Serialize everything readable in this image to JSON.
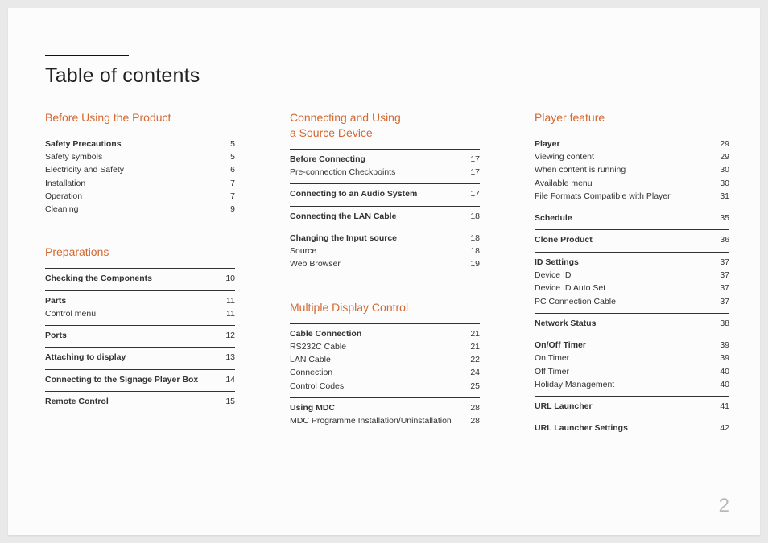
{
  "title": "Table of contents",
  "pageNumber": "2",
  "columns": [
    {
      "sections": [
        {
          "heading": "Before Using the Product",
          "groups": [
            {
              "rows": [
                {
                  "label": "Safety Precautions",
                  "page": "5",
                  "bold": true
                },
                {
                  "label": "Safety symbols",
                  "page": "5"
                },
                {
                  "label": "Electricity and Safety",
                  "page": "6"
                },
                {
                  "label": "Installation",
                  "page": "7"
                },
                {
                  "label": "Operation",
                  "page": "7"
                },
                {
                  "label": "Cleaning",
                  "page": "9"
                }
              ]
            }
          ]
        },
        {
          "heading": "Preparations",
          "groups": [
            {
              "rows": [
                {
                  "label": "Checking the Components",
                  "page": "10",
                  "bold": true
                }
              ]
            },
            {
              "rows": [
                {
                  "label": "Parts",
                  "page": "11",
                  "bold": true
                },
                {
                  "label": "Control menu",
                  "page": "11"
                }
              ]
            },
            {
              "rows": [
                {
                  "label": "Ports",
                  "page": "12",
                  "bold": true
                }
              ]
            },
            {
              "rows": [
                {
                  "label": "Attaching to display",
                  "page": "13",
                  "bold": true
                }
              ]
            },
            {
              "rows": [
                {
                  "label": "Connecting to the Signage Player Box",
                  "page": "14",
                  "bold": true
                }
              ]
            },
            {
              "rows": [
                {
                  "label": "Remote Control",
                  "page": "15",
                  "bold": true
                }
              ]
            }
          ]
        }
      ]
    },
    {
      "sections": [
        {
          "heading": "Connecting and Using\na Source Device",
          "groups": [
            {
              "rows": [
                {
                  "label": "Before Connecting",
                  "page": "17",
                  "bold": true
                },
                {
                  "label": "Pre-connection Checkpoints",
                  "page": "17"
                }
              ]
            },
            {
              "rows": [
                {
                  "label": "Connecting to an Audio System",
                  "page": "17",
                  "bold": true
                }
              ]
            },
            {
              "rows": [
                {
                  "label": "Connecting the LAN Cable",
                  "page": "18",
                  "bold": true
                }
              ]
            },
            {
              "rows": [
                {
                  "label": "Changing the Input source",
                  "page": "18",
                  "bold": true
                },
                {
                  "label": "Source",
                  "page": "18"
                },
                {
                  "label": "Web Browser",
                  "page": "19"
                }
              ]
            }
          ]
        },
        {
          "heading": "Multiple Display Control",
          "groups": [
            {
              "rows": [
                {
                  "label": "Cable Connection",
                  "page": "21",
                  "bold": true
                },
                {
                  "label": "RS232C Cable",
                  "page": "21"
                },
                {
                  "label": "LAN Cable",
                  "page": "22"
                },
                {
                  "label": "Connection",
                  "page": "24"
                },
                {
                  "label": "Control Codes",
                  "page": "25"
                }
              ]
            },
            {
              "rows": [
                {
                  "label": "Using MDC",
                  "page": "28",
                  "bold": true
                },
                {
                  "label": "MDC Programme Installation/Uninstallation",
                  "page": "28"
                }
              ]
            }
          ]
        }
      ]
    },
    {
      "sections": [
        {
          "heading": "Player feature",
          "groups": [
            {
              "rows": [
                {
                  "label": "Player",
                  "page": "29",
                  "bold": true
                },
                {
                  "label": "Viewing content",
                  "page": "29"
                },
                {
                  "label": "When content is running",
                  "page": "30"
                },
                {
                  "label": "Available menu",
                  "page": "30"
                },
                {
                  "label": "File Formats Compatible with Player",
                  "page": "31"
                }
              ]
            },
            {
              "rows": [
                {
                  "label": "Schedule",
                  "page": "35",
                  "bold": true
                }
              ]
            },
            {
              "rows": [
                {
                  "label": "Clone Product",
                  "page": "36",
                  "bold": true
                }
              ]
            },
            {
              "rows": [
                {
                  "label": "ID Settings",
                  "page": "37",
                  "bold": true
                },
                {
                  "label": "Device ID",
                  "page": "37"
                },
                {
                  "label": "Device ID Auto Set",
                  "page": "37"
                },
                {
                  "label": "PC Connection Cable",
                  "page": "37"
                }
              ]
            },
            {
              "rows": [
                {
                  "label": "Network Status",
                  "page": "38",
                  "bold": true
                }
              ]
            },
            {
              "rows": [
                {
                  "label": "On/Off Timer",
                  "page": "39",
                  "bold": true
                },
                {
                  "label": "On Timer",
                  "page": "39"
                },
                {
                  "label": "Off Timer",
                  "page": "40"
                },
                {
                  "label": "Holiday Management",
                  "page": "40"
                }
              ]
            },
            {
              "rows": [
                {
                  "label": "URL Launcher",
                  "page": "41",
                  "bold": true
                }
              ]
            },
            {
              "rows": [
                {
                  "label": "URL Launcher Settings",
                  "page": "42",
                  "bold": true
                }
              ]
            }
          ]
        }
      ]
    }
  ]
}
